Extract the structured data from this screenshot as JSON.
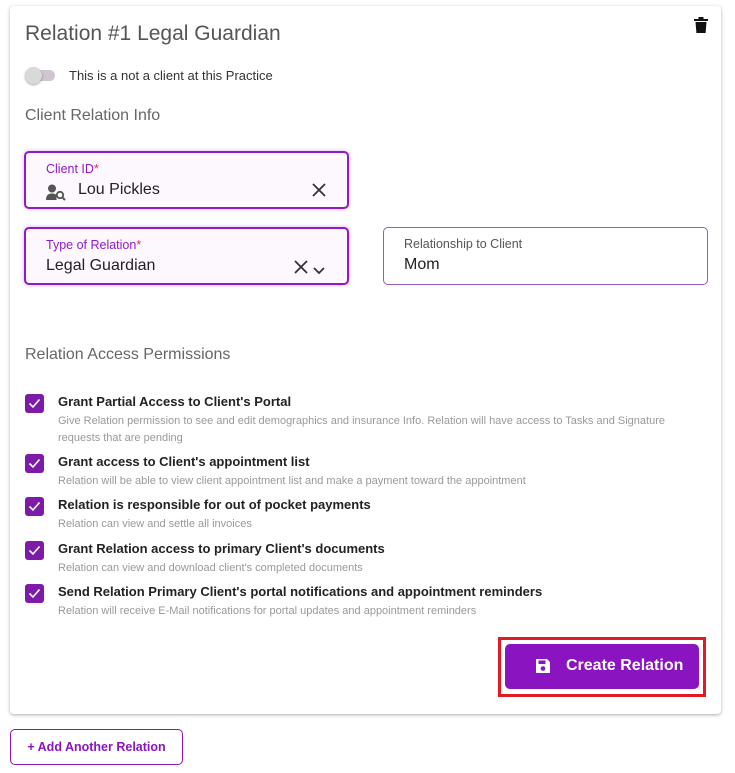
{
  "card": {
    "title": "Relation #1 Legal Guardian",
    "delete_icon": "trash-icon"
  },
  "toggle": {
    "label": "This is a not a client at this Practice",
    "checked": false
  },
  "sections": {
    "relation_info": "Client Relation Info",
    "permissions": "Relation Access Permissions"
  },
  "client_id": {
    "label": "Client ID",
    "required_mark": "*",
    "value": "Lou Pickles",
    "icon": "user-search-icon",
    "clear_icon": "close-icon"
  },
  "type_of_relation": {
    "label": "Type of Relation",
    "required_mark": "*",
    "value": "Legal Guardian",
    "clear_icon": "close-icon",
    "dropdown_icon": "chevron-down-icon"
  },
  "relationship": {
    "label": "Relationship to Client",
    "value": "Mom"
  },
  "permissions": [
    {
      "title": "Grant Partial Access to Client's Portal",
      "description": "Give Relation permission to see and edit demographics and insurance Info. Relation will have access to Tasks and Signature requests that are pending",
      "checked": true
    },
    {
      "title": "Grant access to Client's appointment list",
      "description": "Relation will be able to view client appointment list and make a payment toward the appointment",
      "checked": true
    },
    {
      "title": "Relation is responsible for out of pocket payments",
      "description": "Relation can view and settle all invoices",
      "checked": true
    },
    {
      "title": "Grant Relation access to primary Client's documents",
      "description": "Relation can view and download client's completed documents",
      "checked": true
    },
    {
      "title": "Send Relation Primary Client's portal notifications and appointment reminders",
      "description": "Relation will receive E-Mail notifications for portal updates and appointment reminders",
      "checked": true
    }
  ],
  "create_button": {
    "label": "Create Relation",
    "icon": "save-icon"
  },
  "add_button": {
    "label": "+ Add Another Relation"
  },
  "colors": {
    "accent": "#8a14bf",
    "highlight": "#e01b24"
  }
}
